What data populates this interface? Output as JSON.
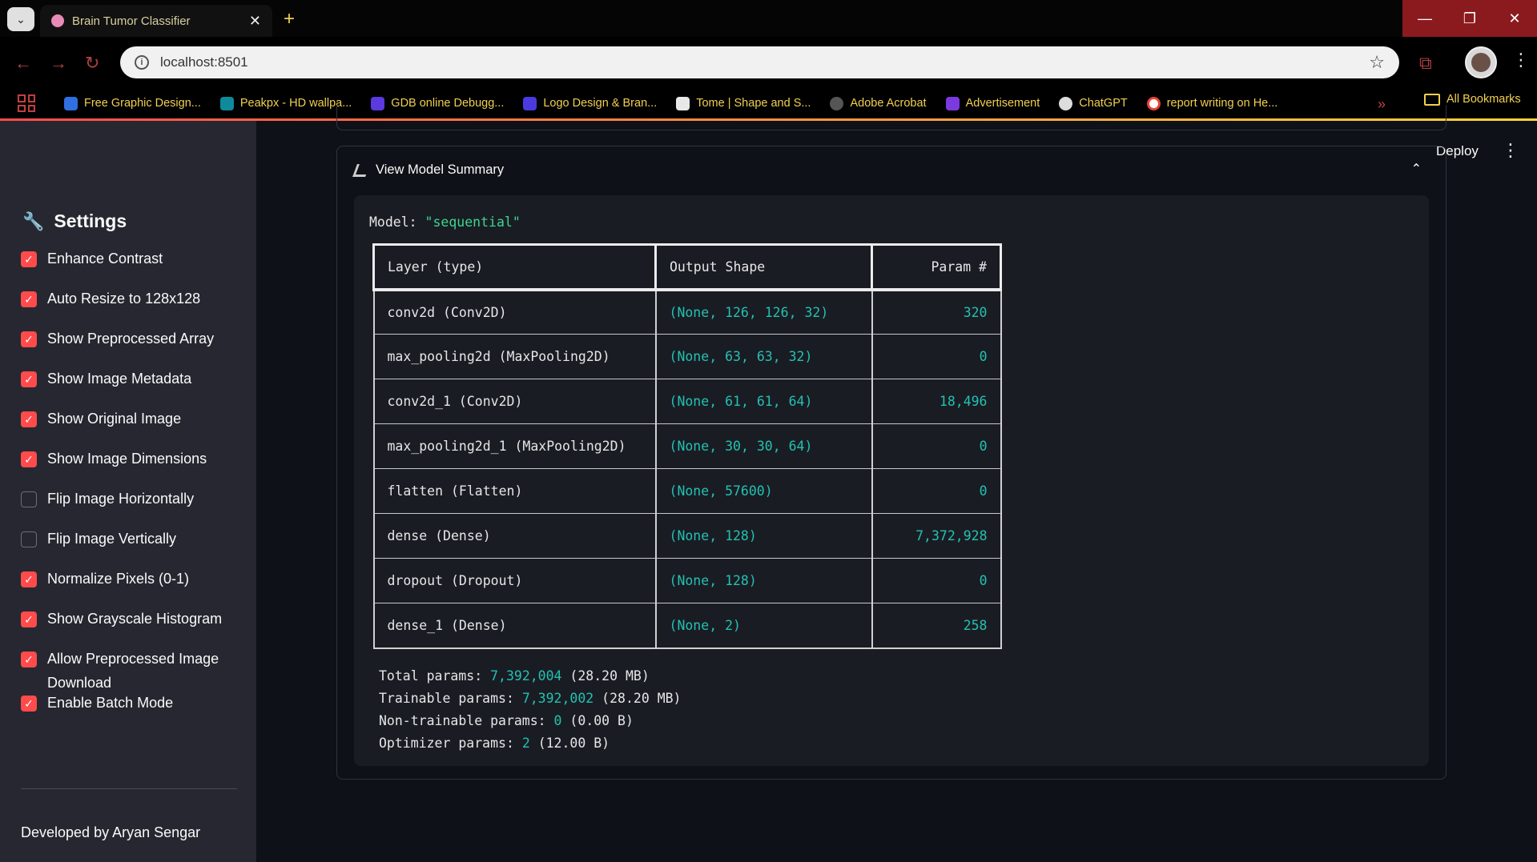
{
  "browser": {
    "tab_title": "Brain Tumor Classifier",
    "url": "localhost:8501",
    "bookmarks": [
      {
        "label": "Free Graphic Design...",
        "color": "#2f6fe0"
      },
      {
        "label": "Peakpx - HD wallpa...",
        "color": "#0f8a9a"
      },
      {
        "label": "GDB online Debugg...",
        "color": "#5b3ae0"
      },
      {
        "label": "Logo Design & Bran...",
        "color": "#4a3ae0"
      },
      {
        "label": "Tome | Shape and S...",
        "color": "#e8e8e8"
      },
      {
        "label": "Adobe Acrobat",
        "color": "#555555"
      },
      {
        "label": "Advertisement",
        "color": "#7a3ae0"
      },
      {
        "label": "ChatGPT",
        "color": "#dddddd"
      },
      {
        "label": "report writing on He...",
        "color": "#ea4335"
      }
    ],
    "all_bookmarks": "All Bookmarks"
  },
  "header": {
    "deploy": "Deploy"
  },
  "sidebar": {
    "title": "Settings",
    "options": [
      {
        "label": "Enhance Contrast",
        "checked": true
      },
      {
        "label": "Auto Resize to 128x128",
        "checked": true
      },
      {
        "label": "Show Preprocessed Array",
        "checked": true
      },
      {
        "label": "Show Image Metadata",
        "checked": true
      },
      {
        "label": "Show Original Image",
        "checked": true
      },
      {
        "label": "Show Image Dimensions",
        "checked": true
      },
      {
        "label": "Flip Image Horizontally",
        "checked": false
      },
      {
        "label": "Flip Image Vertically",
        "checked": false
      },
      {
        "label": "Normalize Pixels (0-1)",
        "checked": true
      },
      {
        "label": "Show Grayscale Histogram",
        "checked": true
      },
      {
        "label": "Allow Preprocessed Image Download",
        "checked": true
      },
      {
        "label": "Enable Batch Mode",
        "checked": true
      }
    ],
    "footer": "Developed by Aryan Sengar"
  },
  "expander": {
    "title": "View Model Summary"
  },
  "model": {
    "label": "Model: ",
    "name": "\"sequential\"",
    "columns": [
      "Layer (type)",
      "Output Shape",
      "Param #"
    ],
    "layers": [
      {
        "name": "conv2d",
        "type": "(Conv2D)",
        "shape": [
          "None",
          "126",
          "126",
          "32"
        ],
        "params": "320"
      },
      {
        "name": "max_pooling2d",
        "type": "(MaxPooling2D)",
        "shape": [
          "None",
          "63",
          "63",
          "32"
        ],
        "params": "0"
      },
      {
        "name": "conv2d_1",
        "type": "(Conv2D)",
        "shape": [
          "None",
          "61",
          "61",
          "64"
        ],
        "params": "18,496"
      },
      {
        "name": "max_pooling2d_1",
        "type": "(MaxPooling2D)",
        "shape": [
          "None",
          "30",
          "30",
          "64"
        ],
        "params": "0"
      },
      {
        "name": "flatten",
        "type": "(Flatten)",
        "shape": [
          "None",
          "57600"
        ],
        "params": "0"
      },
      {
        "name": "dense",
        "type": "(Dense)",
        "shape": [
          "None",
          "128"
        ],
        "params": "7,372,928"
      },
      {
        "name": "dropout",
        "type": "(Dropout)",
        "shape": [
          "None",
          "128"
        ],
        "params": "0"
      },
      {
        "name": "dense_1",
        "type": "(Dense)",
        "shape": [
          "None",
          "2"
        ],
        "params": "258"
      }
    ],
    "totals": [
      {
        "label": "Total params: ",
        "value": "7,392,004",
        "unit": "(28.20 MB)"
      },
      {
        "label": "Trainable params: ",
        "value": "7,392,002",
        "unit": "(28.20 MB)"
      },
      {
        "label": "Non-trainable params: ",
        "value": "0",
        "unit": "(0.00 B)"
      },
      {
        "label": "Optimizer params: ",
        "value": "2",
        "unit": "(12.00 B)"
      }
    ]
  },
  "colors": {
    "accent": "#ff4b4b",
    "number": "#22c2b0",
    "string": "#3dd68c"
  }
}
